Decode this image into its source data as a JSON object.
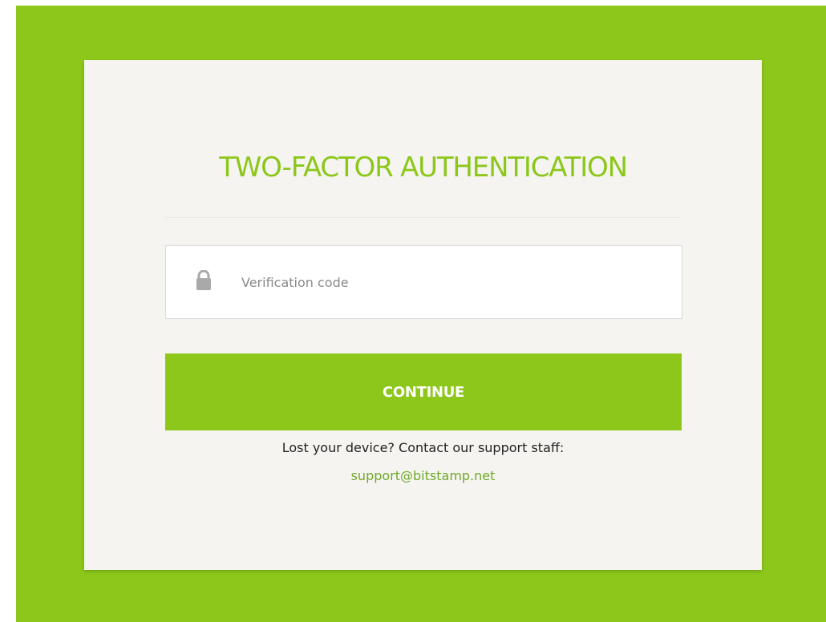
{
  "page": {
    "title": "TWO-FACTOR AUTHENTICATION",
    "background_color": "#8cc71a",
    "card_color": "#f5f4f1"
  },
  "form": {
    "code_placeholder": "Verification code",
    "code_value": "",
    "lock_icon": "lock-icon",
    "continue_label": "CONTINUE",
    "accent_color": "#8cc71a"
  },
  "help": {
    "text": "Lost your device? Contact our support staff:",
    "support_email": "support@bitstamp.net",
    "link_color": "#6fa82a"
  }
}
